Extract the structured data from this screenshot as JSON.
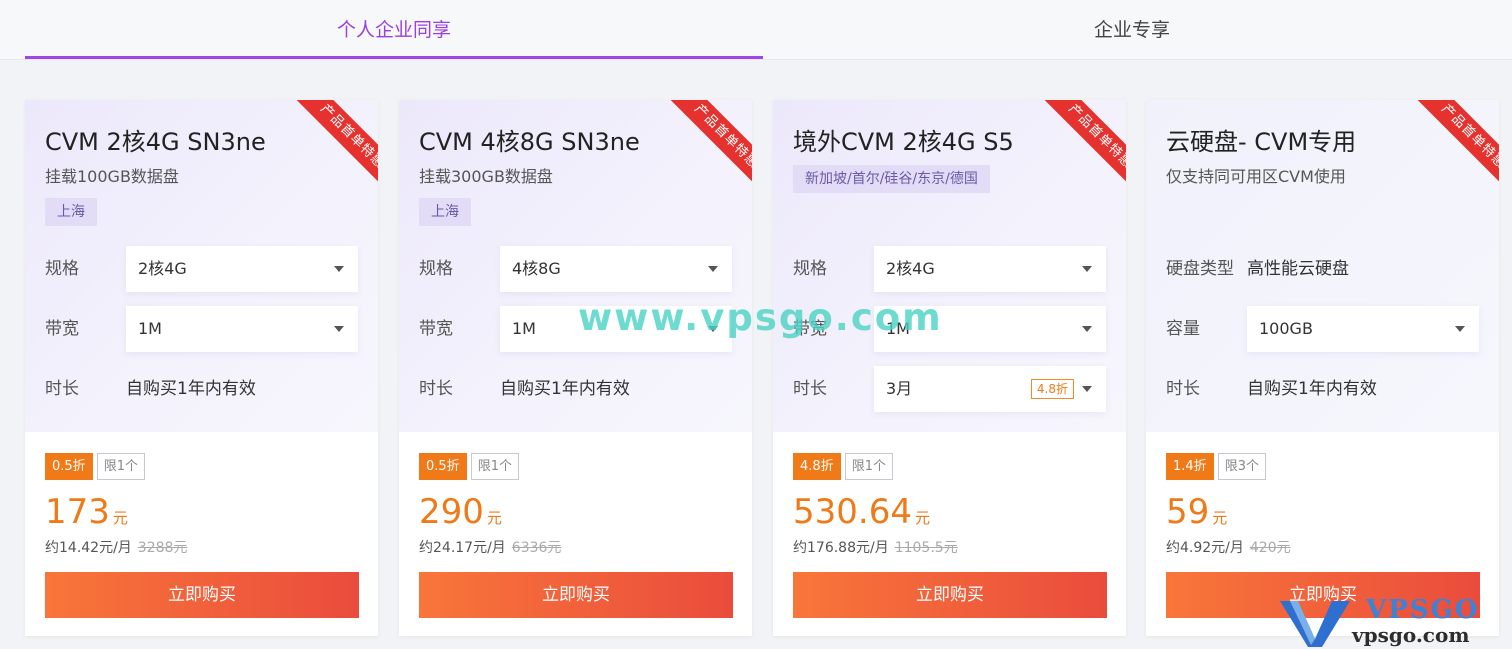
{
  "tabs": [
    {
      "label": "个人企业同享",
      "active": true
    },
    {
      "label": "企业专享",
      "active": false
    }
  ],
  "ribbon_label": "产品首单特惠",
  "cards": [
    {
      "title": "CVM 2核4G SN3ne",
      "subtitle": "挂载100GB数据盘",
      "region": "上海",
      "rows": [
        {
          "label": "规格",
          "value": "2核4G",
          "type": "select"
        },
        {
          "label": "带宽",
          "value": "1M",
          "type": "select"
        },
        {
          "label": "时长",
          "value": "自购买1年内有效",
          "type": "text"
        }
      ],
      "discount": "0.5折",
      "limit": "限1个",
      "price": "173",
      "unit": "元",
      "monthly": "约14.42元/月",
      "original": "3288元",
      "buy_label": "立即购买"
    },
    {
      "title": "CVM 4核8G SN3ne",
      "subtitle": "挂载300GB数据盘",
      "region": "上海",
      "rows": [
        {
          "label": "规格",
          "value": "4核8G",
          "type": "select"
        },
        {
          "label": "带宽",
          "value": "1M",
          "type": "select"
        },
        {
          "label": "时长",
          "value": "自购买1年内有效",
          "type": "text"
        }
      ],
      "discount": "0.5折",
      "limit": "限1个",
      "price": "290",
      "unit": "元",
      "monthly": "约24.17元/月",
      "original": "6336元",
      "buy_label": "立即购买"
    },
    {
      "title": "境外CVM 2核4G S5",
      "subtitle": "",
      "region": "新加坡/首尔/硅谷/东京/德国",
      "rows": [
        {
          "label": "规格",
          "value": "2核4G",
          "type": "select"
        },
        {
          "label": "带宽",
          "value": "1M",
          "type": "select"
        },
        {
          "label": "时长",
          "value": "3月",
          "type": "select",
          "tag": "4.8折"
        }
      ],
      "discount": "4.8折",
      "limit": "限1个",
      "price": "530.64",
      "unit": "元",
      "monthly": "约176.88元/月",
      "original": "1105.5元",
      "buy_label": "立即购买"
    },
    {
      "title": "云硬盘- CVM专用",
      "subtitle": "仅支持同可用区CVM使用",
      "region": "",
      "rows": [
        {
          "label": "硬盘类型",
          "value": "高性能云硬盘",
          "type": "text"
        },
        {
          "label": "容量",
          "value": "100GB",
          "type": "select"
        },
        {
          "label": "时长",
          "value": "自购买1年内有效",
          "type": "text"
        }
      ],
      "discount": "1.4折",
      "limit": "限3个",
      "price": "59",
      "unit": "元",
      "monthly": "约4.92元/月",
      "original": "420元",
      "buy_label": "立即购买"
    }
  ],
  "watermark": "www.vpsgo.com",
  "logo": {
    "brand": "VPSGO",
    "domain": "vpsgo.com"
  },
  "colors": {
    "accent": "#a046e6",
    "price": "#f07a18",
    "ribbon": "#e5322e",
    "buy_start": "#f8763a",
    "buy_end": "#ea4c3c"
  }
}
